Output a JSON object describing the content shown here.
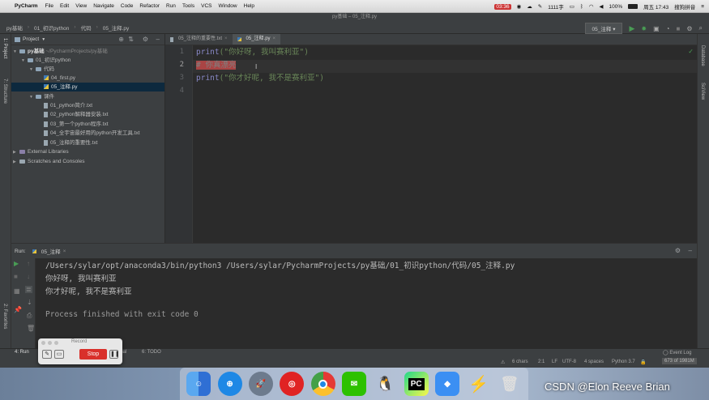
{
  "mac_menu": {
    "apple": "",
    "app": "PyCharm",
    "items": [
      "File",
      "Edit",
      "View",
      "Navigate",
      "Code",
      "Refactor",
      "Run",
      "Tools",
      "VCS",
      "Window",
      "Help"
    ],
    "tray": {
      "record_time": "03:36",
      "counter": "1111字",
      "battery": "100%",
      "datetime": "周五 17:43",
      "search": "搜狗拼音"
    }
  },
  "window": {
    "title": "py基础 – 05_注释.py"
  },
  "navbar": {
    "crumbs": [
      "py基础",
      "01_初识python",
      "代码",
      "05_注释.py"
    ],
    "run_config": "05_注释"
  },
  "left_stripe": {
    "project": "1: Project",
    "structure": "7: Structure",
    "favorites": "2: Favorites"
  },
  "right_stripe": {
    "database": "Database",
    "sciview": "SciView"
  },
  "project": {
    "header": "Project",
    "tree": [
      {
        "label": "py基础",
        "suffix": "~/PycharmProjects/py基础"
      },
      {
        "label": "01_初识python"
      },
      {
        "label": "代码"
      },
      {
        "label": "04_first.py"
      },
      {
        "label": "05_注释.py"
      },
      {
        "label": "课件"
      },
      {
        "label": "01_python简介.txt"
      },
      {
        "label": "02_python解释器安装.txt"
      },
      {
        "label": "03_第一个python程序.txt"
      },
      {
        "label": "04_全宇宙最好用的python开发工具.txt"
      },
      {
        "label": "05_注释的重要性.txt"
      },
      {
        "label": "External Libraries"
      },
      {
        "label": "Scratches and Consoles"
      }
    ]
  },
  "editor": {
    "tabs": [
      {
        "label": "05_注释的重要性.txt"
      },
      {
        "label": "05_注释.py"
      }
    ],
    "lines": [
      {
        "num": "1",
        "fn": "print",
        "text": "(\"你好呀, 我叫赛利亚\")"
      },
      {
        "num": "2",
        "comment": "# 你真漂亮"
      },
      {
        "num": "3",
        "fn": "print",
        "text": "(\"你才好呢, 我不是赛利亚\")"
      },
      {
        "num": "4"
      }
    ]
  },
  "run": {
    "label": "Run:",
    "tab": "05_注释",
    "command": "/Users/sylar/opt/anaconda3/bin/python3 /Users/sylar/PycharmProjects/py基础/01_初识python/代码/05_注释.py",
    "output": [
      "你好呀, 我叫赛利亚",
      "你才好呢, 我不是赛利亚"
    ],
    "exit": "Process finished with exit code 0"
  },
  "bottom_tabs": {
    "run": "4: Run",
    "terminal": "minal",
    "todo": "6: TODO",
    "event_log": "Event Log"
  },
  "status": {
    "chars": "6 chars",
    "pos": "2:1",
    "le": "LF",
    "enc": "UTF-8",
    "indent": "4 spaces",
    "interp": "Python 3.7",
    "mem": "673 of 1981M"
  },
  "record_widget": {
    "title": "Record",
    "stop": "Stop"
  },
  "watermark": "CSDN @Elon Reeve Brian",
  "colors": {
    "accent": "#4a88c7",
    "selection": "#0d293e",
    "stop": "#d9302b",
    "run_green": "#499c54"
  }
}
